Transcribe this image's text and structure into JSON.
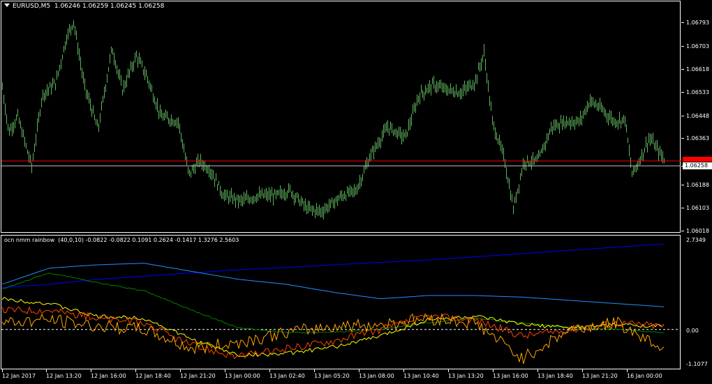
{
  "main_chart": {
    "symbol": "EURUSD,M5",
    "ohlc": "1.06246 1.06259 1.06245 1.06258",
    "price_labels": [
      "1.06793",
      "1.06703",
      "1.06618",
      "1.06533",
      "1.06448",
      "1.06363",
      "1.06258",
      "1.06188",
      "1.06103",
      "1.06018"
    ],
    "current_price": "1.06258",
    "line_colors": {
      "red": "#ff0000",
      "grey": "#c0c0c0"
    }
  },
  "indicator": {
    "title": "ocn nmm rainbow",
    "params": "(40,0,10)",
    "values": "-0.0822 -0.0822 0.1091 0.2624 -0.1417 1.3276 2.5603",
    "scale_labels": [
      "2.7349",
      "0.00",
      "-1.1077"
    ]
  },
  "time_axis": [
    "12 Jan 2017",
    "12 Jan 13:20",
    "12 Jan 16:00",
    "12 Jan 18:40",
    "12 Jan 21:20",
    "13 Jan 00:00",
    "13 Jan 02:40",
    "13 Jan 05:20",
    "13 Jan 08:00",
    "13 Jan 10:40",
    "13 Jan 13:20",
    "13 Jan 16:00",
    "13 Jan 18:40",
    "13 Jan 21:20",
    "16 Jan 00:00"
  ],
  "chart_data": [
    {
      "type": "line",
      "title": "EURUSD,M5",
      "x": [
        "12 Jan 2017",
        "12 Jan 13:20",
        "12 Jan 16:00",
        "12 Jan 18:40",
        "12 Jan 21:20",
        "13 Jan 00:00",
        "13 Jan 02:40",
        "13 Jan 05:20",
        "13 Jan 08:00",
        "13 Jan 10:40",
        "13 Jan 13:20",
        "13 Jan 16:00",
        "13 Jan 18:40",
        "13 Jan 21:20",
        "16 Jan 00:00"
      ],
      "series": [
        {
          "values": [
            1.064,
            1.067,
            1.0656,
            1.0654,
            1.0616,
            1.0612,
            1.0612,
            1.0609,
            1.0626,
            1.0653,
            1.0656,
            1.0612,
            1.0637,
            1.0643,
            1.0626
          ]
        }
      ],
      "ylim": [
        1.0599,
        1.0685
      ],
      "yticks": [
        "1.06793",
        "1.06703",
        "1.06618",
        "1.06533",
        "1.06448",
        "1.06363",
        "1.06258",
        "1.06188",
        "1.06103",
        "1.06018"
      ]
    },
    {
      "type": "line",
      "title": "ocn nmm rainbow (40,0,10)",
      "x": [
        "12 Jan 2017",
        "12 Jan 13:20",
        "12 Jan 16:00",
        "12 Jan 18:40",
        "12 Jan 21:20",
        "13 Jan 00:00",
        "13 Jan 02:40",
        "13 Jan 05:20",
        "13 Jan 08:00",
        "13 Jan 10:40",
        "13 Jan 13:20",
        "13 Jan 16:00",
        "13 Jan 18:40",
        "13 Jan 21:20",
        "16 Jan 00:00"
      ],
      "series": [
        {
          "color": "#0000ff",
          "values": [
            1.3,
            1.4,
            1.55,
            1.65,
            1.75,
            1.85,
            1.92,
            2.0,
            2.08,
            2.15,
            2.25,
            2.35,
            2.45,
            2.55,
            2.65
          ]
        },
        {
          "color": "#1e90ff",
          "values": [
            1.4,
            1.9,
            2.0,
            2.05,
            1.8,
            1.55,
            1.4,
            1.15,
            0.95,
            1.05,
            1.05,
            1.0,
            0.9,
            0.8,
            0.7
          ]
        },
        {
          "color": "#008000",
          "values": [
            1.25,
            1.75,
            1.45,
            1.2,
            0.6,
            0.05,
            -0.1,
            -0.08,
            0.0,
            0.2,
            0.35,
            0.2,
            0.05,
            0.0,
            -0.1
          ]
        },
        {
          "color": "#ffff00",
          "values": [
            0.95,
            0.8,
            0.4,
            0.35,
            -0.3,
            -0.8,
            -0.75,
            -0.55,
            -0.2,
            0.3,
            0.4,
            0.15,
            0.05,
            0.15,
            0.1
          ]
        },
        {
          "color": "#ff4500",
          "values": [
            0.6,
            0.6,
            0.35,
            0.2,
            -0.5,
            -0.85,
            -0.6,
            -0.35,
            0.0,
            0.4,
            0.3,
            -0.2,
            0.0,
            0.2,
            0.1
          ]
        },
        {
          "color": "#ffa500",
          "values": [
            0.2,
            0.3,
            0.1,
            0.0,
            -0.6,
            -0.4,
            -0.1,
            0.1,
            0.15,
            0.35,
            0.2,
            -0.9,
            0.0,
            0.2,
            -0.6
          ]
        }
      ],
      "ylim": [
        -1.1077,
        2.7349
      ],
      "yticks": [
        "2.7349",
        "0.00",
        "-1.1077"
      ]
    }
  ]
}
